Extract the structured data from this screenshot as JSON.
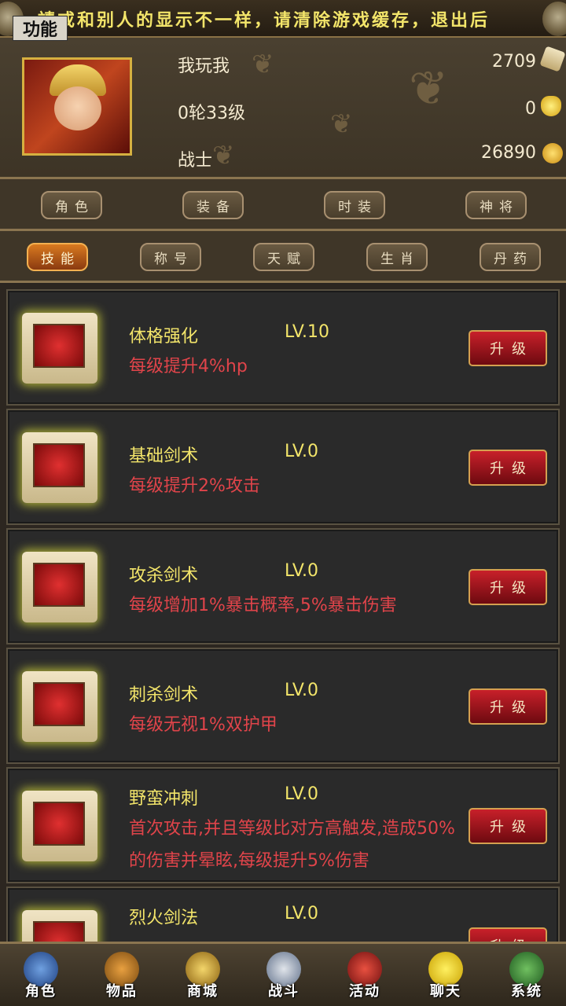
{
  "banner": {
    "notice": "請或和别人的显示不一样，请清除游戏缓存，退出后",
    "func_label": "功能"
  },
  "player": {
    "name": "我玩我",
    "level": "0轮33级",
    "class": "战士",
    "scroll_count": "2709",
    "gold_ingot": "0",
    "coins": "26890"
  },
  "tabs_primary": [
    "角色",
    "装备",
    "时装",
    "神将"
  ],
  "tabs_secondary": [
    "技能",
    "称号",
    "天赋",
    "生肖",
    "丹药"
  ],
  "active_tab": "技能",
  "skills": [
    {
      "name": "体格强化",
      "level": "LV.10",
      "desc": "每级提升4%hp",
      "button": "升级"
    },
    {
      "name": "基础剑术",
      "level": "LV.0",
      "desc": "每级提升2%攻击",
      "button": "升级"
    },
    {
      "name": "攻杀剑术",
      "level": "LV.0",
      "desc": "每级增加1%暴击概率,5%暴击伤害",
      "button": "升级"
    },
    {
      "name": "刺杀剑术",
      "level": "LV.0",
      "desc": "每级无视1%双护甲",
      "button": "升级"
    },
    {
      "name": "野蛮冲刺",
      "level": "LV.0",
      "desc": "首次攻击,并且等级比对方高触发,造成50%的伤害并晕眩,每级提升5%伤害",
      "button": "升级"
    },
    {
      "name": "烈火剑法",
      "level": "LV.0",
      "desc": "",
      "button": "升级"
    }
  ],
  "nav": [
    "角色",
    "物品",
    "商城",
    "战斗",
    "活动",
    "聊天",
    "系统"
  ],
  "colors": {
    "accent_yellow": "#f3e56a",
    "desc_red": "#e0444a",
    "button_red": "#c8202a"
  }
}
